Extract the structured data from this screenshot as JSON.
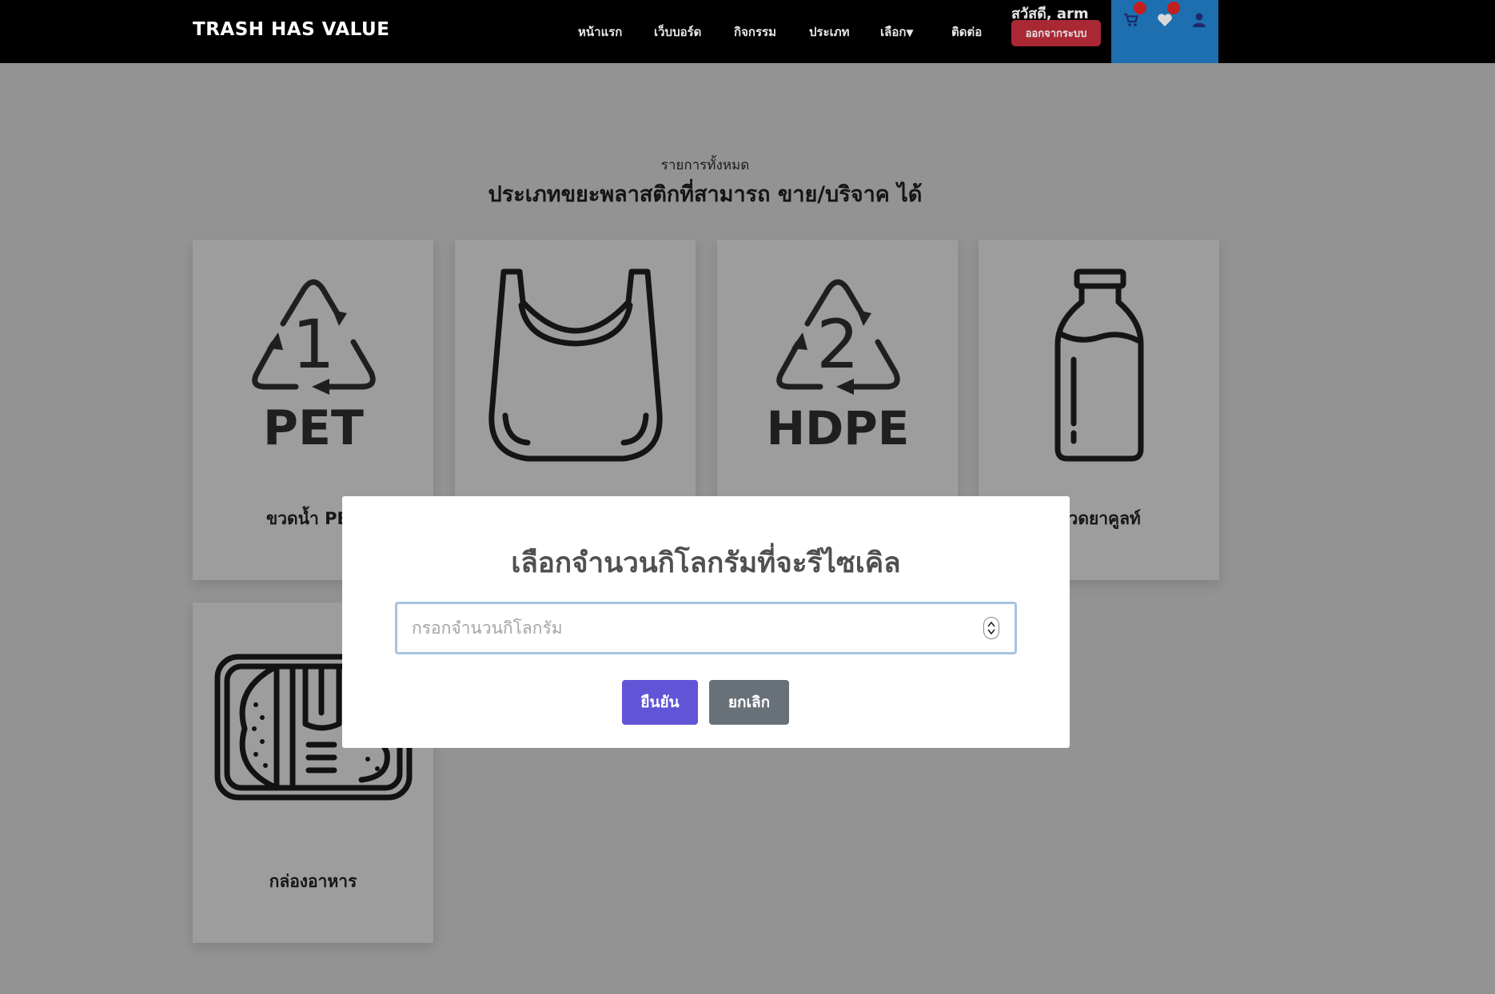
{
  "navbar": {
    "brand": "TRASH HAS VALUE",
    "links": [
      {
        "label": "หน้าแรก"
      },
      {
        "label": "เว็บบอร์ด"
      },
      {
        "label": "กิจกรรม"
      },
      {
        "label": "ประเภท"
      },
      {
        "label": "เลือก",
        "caret": "▼"
      },
      {
        "label": "ติดต่อ"
      }
    ],
    "greeting": "สวัสดี, arm",
    "logout_label": "ออกจากระบบ",
    "icons": [
      "cart-icon",
      "heart-icon",
      "user-icon"
    ]
  },
  "page": {
    "subtitle": "รายการทั้งหมด",
    "heading": "ประเภทขยะพลาสติกที่สามารถ ขาย/บริจาค ได้"
  },
  "cards": [
    {
      "label": "ขวดน้ำ PET",
      "icon": "pet-recycle-icon",
      "icon_text": {
        "number": "1",
        "code": "PET"
      }
    },
    {
      "label": "",
      "icon": "plastic-bag-icon"
    },
    {
      "label": "",
      "icon": "hdpe-recycle-icon",
      "icon_text": {
        "number": "2",
        "code": "HDPE"
      }
    },
    {
      "label": "ขวดยาคูลท์",
      "icon": "bottle-icon"
    },
    {
      "label": "กล่องอาหาร",
      "icon": "food-box-icon"
    }
  ],
  "modal": {
    "title": "เลือกจำนวนกิโลกรัมที่จะรีไซเคิล",
    "input_placeholder": "กรอกจำนวนกิโลกรัม",
    "input_value": "",
    "confirm_label": "ยืนยัน",
    "cancel_label": "ยกเลิก"
  },
  "colors": {
    "navbar_bg": "#000000",
    "overlay_bg": "#939393",
    "icon_panel": "#1d6fb0",
    "logout": "#a92834",
    "confirm": "#6254d6",
    "cancel": "#687078",
    "badge": "#c21f1f"
  }
}
